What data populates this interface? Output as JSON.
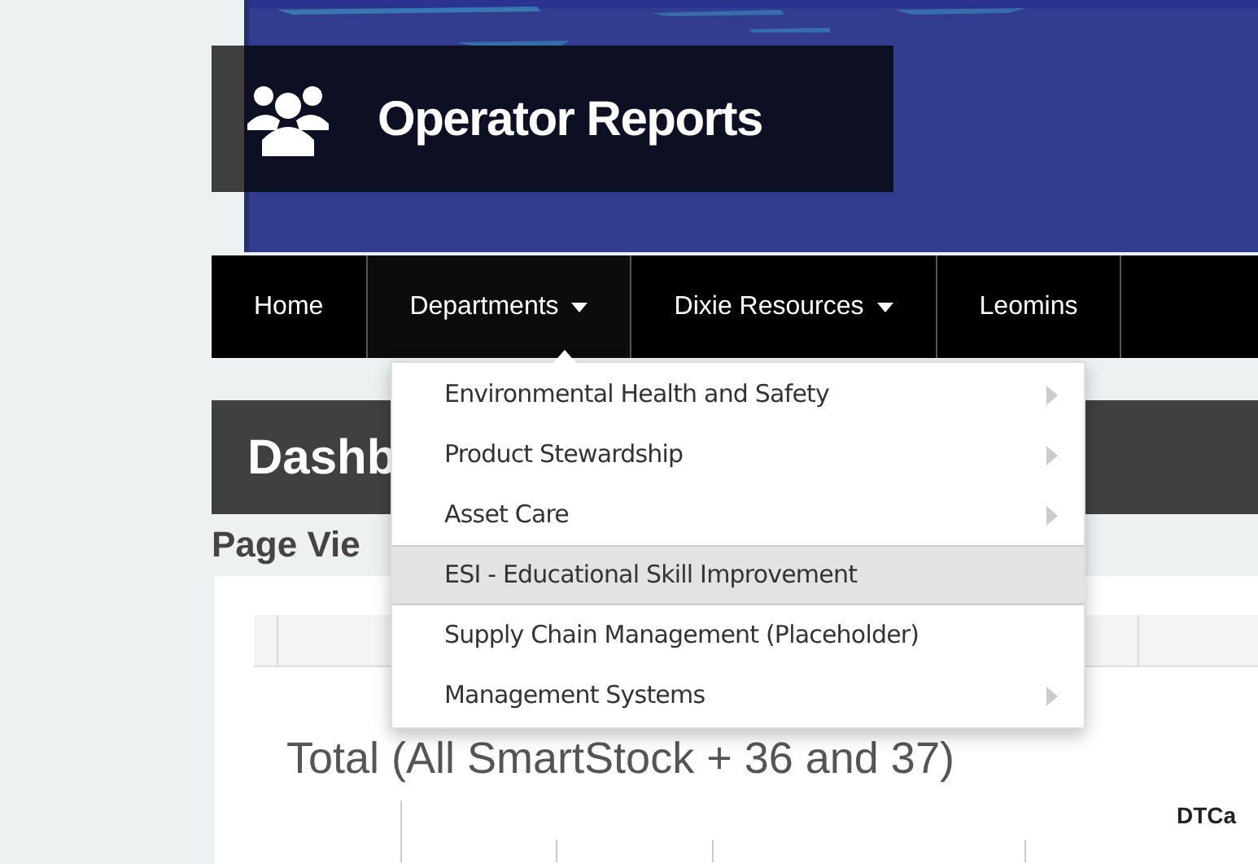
{
  "header": {
    "title": "Operator Reports"
  },
  "nav": {
    "items": [
      {
        "label": "Home",
        "dropdown": false,
        "selected": false
      },
      {
        "label": "Departments",
        "dropdown": true,
        "selected": true
      },
      {
        "label": "Dixie Resources",
        "dropdown": true,
        "selected": false
      },
      {
        "label": "Leomins",
        "dropdown": false,
        "selected": false
      }
    ]
  },
  "dropdown_menu": {
    "items": [
      {
        "label": "Environmental Health and Safety",
        "submenu": true,
        "selected": false
      },
      {
        "label": "Product Stewardship",
        "submenu": true,
        "selected": false
      },
      {
        "label": "Asset Care",
        "submenu": true,
        "selected": false
      },
      {
        "label": "ESI - Educational Skill Improvement",
        "submenu": false,
        "selected": true
      },
      {
        "label": "Supply Chain Management (Placeholder)",
        "submenu": false,
        "selected": false
      },
      {
        "label": "Management Systems",
        "submenu": true,
        "selected": false
      }
    ]
  },
  "section_title": "Dashb",
  "subtitle": "Page Vie",
  "chart_title": "Total (All SmartStock + 36 and 37)",
  "chart_label": "DTCa"
}
